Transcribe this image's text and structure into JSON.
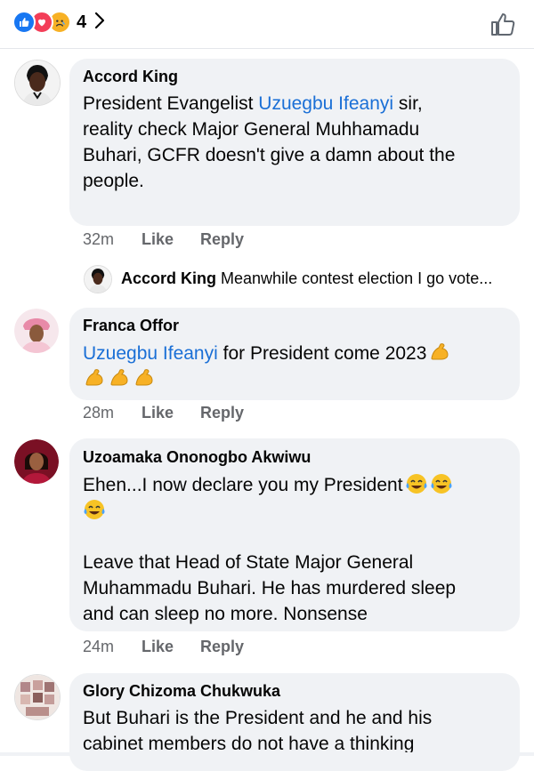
{
  "header": {
    "reaction_count": "4",
    "reactions": [
      "like-icon",
      "love-icon",
      "sad-icon"
    ]
  },
  "colors": {
    "link": "#1a6fd6",
    "like": "#1877f2",
    "love": "#f33e58",
    "sad": "#f7b125",
    "bubble": "#f0f2f5",
    "meta": "#65676b"
  },
  "comments": [
    {
      "author": "Accord King",
      "text_lines": [
        {
          "pre": "President Evangelist ",
          "link": "Uzuegbu Ifeanyi",
          "post": " sir,"
        },
        {
          "pre": "reality check Major General Muhhamadu",
          "link": "",
          "post": ""
        },
        {
          "pre": "Buhari, GCFR doesn't give a damn about the",
          "link": "",
          "post": ""
        },
        {
          "pre": "people.",
          "link": "",
          "post": ""
        }
      ],
      "time": "32m",
      "like": "Like",
      "reply": "Reply"
    },
    {
      "author": "Franca Offor",
      "line1_link": "Uzuegbu Ifeanyi",
      "line1_post": " for President come 2023",
      "time": "28m",
      "like": "Like",
      "reply": "Reply"
    },
    {
      "author": "Uzoamaka Ononogbo Akwiwu",
      "line1": "Ehen...I now declare you my President",
      "para2": [
        "Leave that Head of State Major General",
        "Muhammadu Buhari. He has murdered sleep",
        "and can sleep no more. Nonsense"
      ],
      "time": "24m",
      "like": "Like",
      "reply": "Reply"
    },
    {
      "author": "Glory Chizoma Chukwuka",
      "text_lines": [
        "But Buhari is the President and he and his",
        "cabinet members do not have a thinking"
      ]
    }
  ],
  "reply_preview": {
    "author": "Accord King",
    "text": "Meanwhile contest election I go vote..."
  }
}
